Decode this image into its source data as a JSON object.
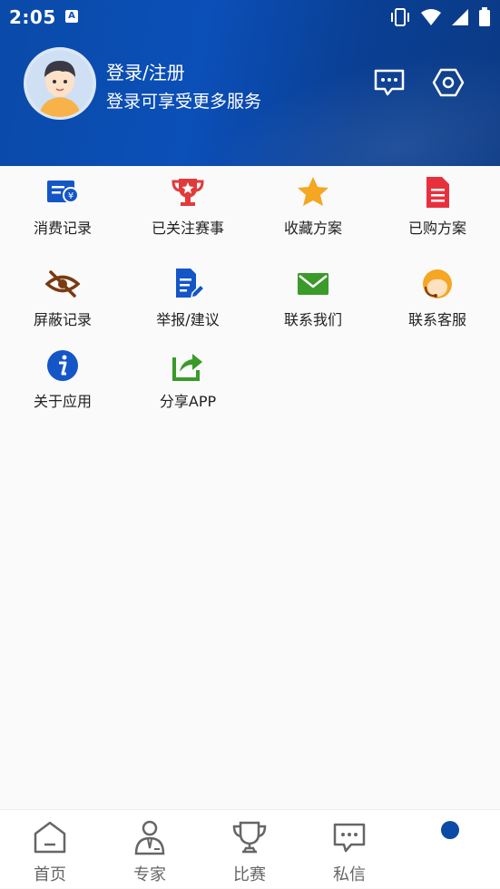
{
  "status_bar": {
    "time": "2:05",
    "app_badge": "A"
  },
  "profile": {
    "title": "登录/注册",
    "subtitle": "登录可享受更多服务"
  },
  "menu": {
    "items": [
      {
        "label": "消费记录",
        "icon": "receipt-yuan-icon",
        "color": "#1456c7"
      },
      {
        "label": "已关注赛事",
        "icon": "trophy-star-icon",
        "color": "#e23a3a"
      },
      {
        "label": "收藏方案",
        "icon": "star-icon",
        "color": "#f5a623"
      },
      {
        "label": "已购方案",
        "icon": "document-icon",
        "color": "#e8303c"
      },
      {
        "label": "屏蔽记录",
        "icon": "eye-off-icon",
        "color": "#7a3a12"
      },
      {
        "label": "举报/建议",
        "icon": "document-edit-icon",
        "color": "#1456c7"
      },
      {
        "label": "联系我们",
        "icon": "mail-icon",
        "color": "#3a9a2a"
      },
      {
        "label": "联系客服",
        "icon": "customer-service-icon",
        "color": "#f5a623"
      },
      {
        "label": "关于应用",
        "icon": "info-icon",
        "color": "#1456c7"
      },
      {
        "label": "分享APP",
        "icon": "share-icon",
        "color": "#3a9a2a"
      }
    ]
  },
  "tabbar": {
    "tabs": [
      {
        "label": "首页",
        "icon": "home-icon"
      },
      {
        "label": "专家",
        "icon": "expert-icon"
      },
      {
        "label": "比赛",
        "icon": "trophy-icon"
      },
      {
        "label": "私信",
        "icon": "message-icon"
      },
      {
        "label": "",
        "icon": "profile-dot-icon",
        "color": "#0c4aa8"
      }
    ]
  }
}
